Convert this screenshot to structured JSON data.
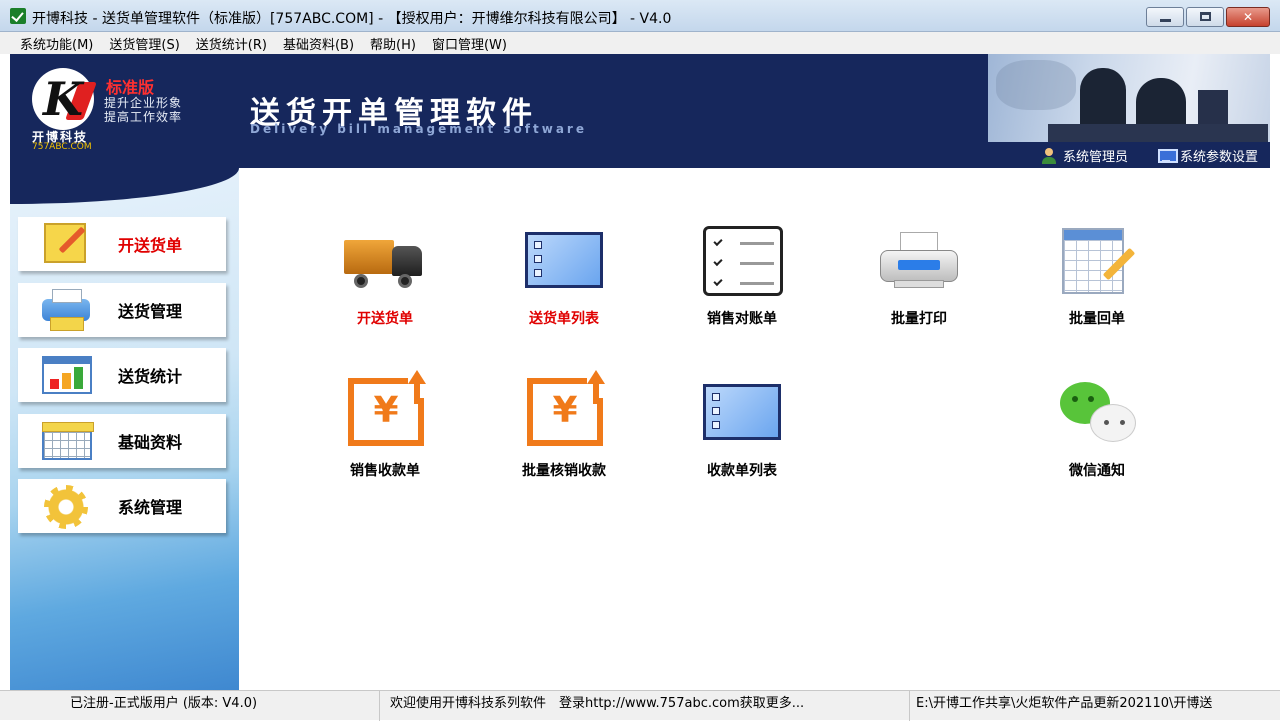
{
  "window": {
    "title": "开博科技 - 送货单管理软件（标准版）[757ABC.COM] - 【授权用户：开博维尔科技有限公司】 - V4.0",
    "min_glyph": "",
    "max_glyph": "",
    "close_glyph": "✕"
  },
  "menu": [
    {
      "label": "系统功能(M)"
    },
    {
      "label": "送货管理(S)"
    },
    {
      "label": "送货统计(R)"
    },
    {
      "label": "基础资料(B)"
    },
    {
      "label": "帮助(H)"
    },
    {
      "label": "窗口管理(W)"
    }
  ],
  "banner": {
    "logo_letter": "K",
    "edition": "标准版",
    "slogan_line1": "提升企业形象",
    "slogan_line2": "提高工作效率",
    "brand": "开博科技",
    "domain": "757ABC.COM",
    "title": "送货开单管理软件",
    "subtitle": "Delivery bill management software",
    "tools": [
      {
        "label": "系统管理员",
        "icon": "user-icon"
      },
      {
        "label": "系统参数设置",
        "icon": "monitor-icon"
      }
    ]
  },
  "sidebar": {
    "items": [
      {
        "label": "开送货单",
        "icon": "pencil-note-icon",
        "active": true
      },
      {
        "label": "送货管理",
        "icon": "printer-icon",
        "active": false
      },
      {
        "label": "送货统计",
        "icon": "bar-chart-icon",
        "active": false
      },
      {
        "label": "基础资料",
        "icon": "spreadsheet-icon",
        "active": false
      },
      {
        "label": "系统管理",
        "icon": "gear-icon",
        "active": false
      }
    ]
  },
  "tiles": [
    {
      "label": "开送货单",
      "icon": "truck-icon",
      "highlight": true
    },
    {
      "label": "送货单列表",
      "icon": "list-window-icon",
      "highlight": true
    },
    {
      "label": "销售对账单",
      "icon": "checklist-icon",
      "highlight": false
    },
    {
      "label": "批量打印",
      "icon": "printer-icon",
      "highlight": false
    },
    {
      "label": "批量回单",
      "icon": "spreadsheet-edit-icon",
      "highlight": false
    },
    {
      "label": "销售收款单",
      "icon": "yen-receipt-icon",
      "highlight": false,
      "symbol": "¥"
    },
    {
      "label": "批量核销收款",
      "icon": "yen-receipt-icon",
      "highlight": false,
      "symbol": "¥"
    },
    {
      "label": "收款单列表",
      "icon": "list-window-icon",
      "highlight": false
    },
    {
      "label": "微信通知",
      "icon": "wechat-icon",
      "highlight": false
    }
  ],
  "status": {
    "registration": "已注册-正式版用户 (版本: V4.0)",
    "welcome": "欢迎使用开博科技系列软件　登录http://www.757abc.com获取更多...",
    "path": "E:\\开博工作共享\\火炬软件产品更新202110\\开博送"
  },
  "colors": {
    "banner_bg": "#16275c",
    "active_red": "#e00000",
    "accent_orange": "#f07a1a"
  }
}
